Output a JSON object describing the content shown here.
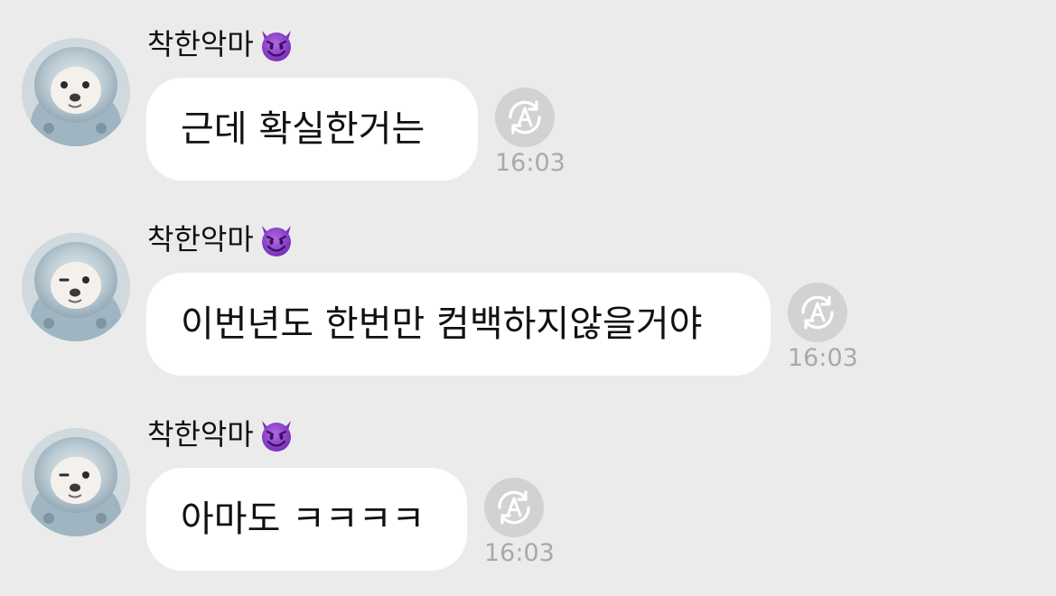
{
  "messages": [
    {
      "sender": "착한악마",
      "sender_emoji": "smiling-devil-emoji",
      "text": "근데 확실한거는",
      "time": "16:03",
      "action_icon": "auto-translate-icon"
    },
    {
      "sender": "착한악마",
      "sender_emoji": "smiling-devil-emoji",
      "text": "이번년도 한번만 컴백하지않을거야",
      "time": "16:03",
      "action_icon": "auto-translate-icon"
    },
    {
      "sender": "착한악마",
      "sender_emoji": "smiling-devil-emoji",
      "text": "아마도 ㅋㅋㅋㅋ",
      "time": "16:03",
      "action_icon": "auto-translate-icon"
    }
  ],
  "colors": {
    "background": "#ebebeb",
    "bubble": "#ffffff",
    "timestamp": "#a9a9a9",
    "devil": "#8b3fc7"
  }
}
